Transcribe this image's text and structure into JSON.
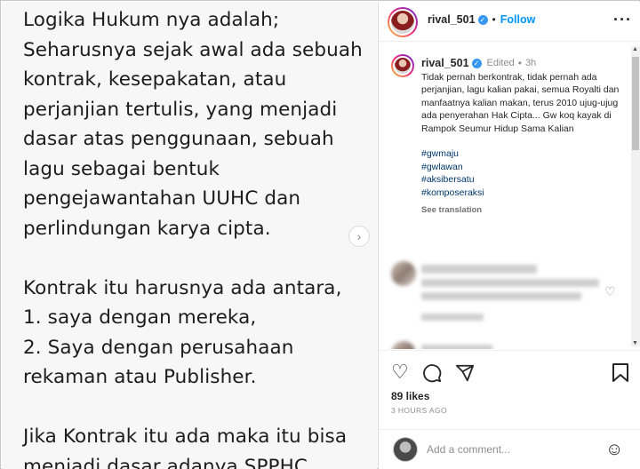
{
  "image": {
    "lines": [
      "Logika Hukum nya adalah;",
      "Seharusnya sejak awal ada sebuah",
      "kontrak, kesepakatan, atau",
      "perjanjian tertulis, yang menjadi",
      "dasar atas penggunaan, sebuah",
      "lagu sebagai bentuk",
      "pengejawantahan UUHC dan",
      "perlindungan karya cipta.",
      "",
      "Kontrak itu harusnya ada antara,",
      "1. saya dengan mereka,",
      "2. Saya dengan perusahaan",
      "rekaman atau Publisher.",
      "",
      "Jika Kontrak itu ada maka itu bisa",
      "menjadi dasar adanya SPPHC."
    ],
    "next_icon": "chevron-right-icon"
  },
  "header": {
    "username": "rival_501",
    "separator": "•",
    "follow_label": "Follow",
    "more_icon": "more-horizontal-icon"
  },
  "caption": {
    "username": "rival_501",
    "edited": "Edited",
    "separator": "•",
    "time": "3h",
    "text": "Tidak pernah berkontrak, tidak pernah ada perjanjian, lagu kalian pakai, semua Royalti dan manfaatnya kalian makan, terus 2010 ujug-ujug ada penyerahan Hak Cipta... Gw koq kayak di Rampok Seumur Hidup Sama Kalian",
    "hashtags": [
      "#gwmaju",
      "#gwlawan",
      "#aksibersatu",
      "#komposeraksi"
    ],
    "see_translation": "See translation"
  },
  "actions": {
    "likes": "89 likes",
    "posted_ago": "3 HOURS AGO",
    "icons": [
      "heart-icon",
      "comment-icon",
      "share-icon",
      "bookmark-icon"
    ]
  },
  "comment_box": {
    "placeholder": "Add a comment...",
    "emoji_icon": "smiley-icon"
  }
}
